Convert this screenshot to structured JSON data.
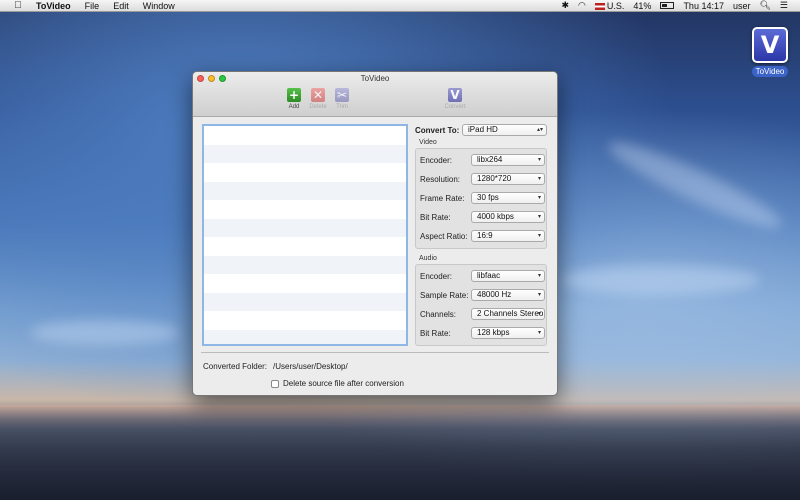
{
  "menubar": {
    "app_name": "ToVideo",
    "items": [
      "File",
      "Edit",
      "Window"
    ],
    "status": {
      "input_source": "U.S.",
      "battery": "41%",
      "clock": "Thu 14:17",
      "user": "user"
    }
  },
  "desktop": {
    "icon_label": "ToVideo",
    "icon_letter": "V"
  },
  "window": {
    "title": "ToVideo",
    "toolbar": {
      "add": "Add",
      "delete": "Delete",
      "trim": "Trim",
      "convert": "Convert"
    }
  },
  "settings": {
    "convert_to_label": "Convert To:",
    "convert_to_value": "iPad HD",
    "video": {
      "title": "Video",
      "encoder_label": "Encoder:",
      "encoder_value": "libx264",
      "resolution_label": "Resolution:",
      "resolution_value": "1280*720",
      "frame_rate_label": "Frame Rate:",
      "frame_rate_value": "30 fps",
      "bit_rate_label": "Bit Rate:",
      "bit_rate_value": "4000 kbps",
      "aspect_ratio_label": "Aspect Ratio:",
      "aspect_ratio_value": "16:9"
    },
    "audio": {
      "title": "Audio",
      "encoder_label": "Encoder:",
      "encoder_value": "libfaac",
      "sample_rate_label": "Sample Rate:",
      "sample_rate_value": "48000 Hz",
      "channels_label": "Channels:",
      "channels_value": "2 Channels Stereo",
      "bit_rate_label": "Bit Rate:",
      "bit_rate_value": "128 kbps"
    }
  },
  "footer": {
    "folder_label": "Converted Folder:",
    "folder_value": "/Users/user/Desktop/",
    "delete_source_label": "Delete source file after conversion"
  }
}
